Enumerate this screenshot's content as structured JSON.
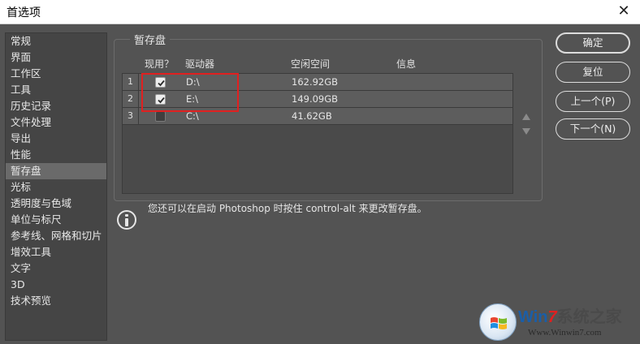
{
  "window": {
    "title": "首选项",
    "close_glyph": "✕"
  },
  "sidebar": {
    "items": [
      {
        "label": "常规"
      },
      {
        "label": "界面"
      },
      {
        "label": "工作区"
      },
      {
        "label": "工具"
      },
      {
        "label": "历史记录"
      },
      {
        "label": "文件处理"
      },
      {
        "label": "导出"
      },
      {
        "label": "性能"
      },
      {
        "label": "暂存盘",
        "active": true
      },
      {
        "label": "光标"
      },
      {
        "label": "透明度与色域"
      },
      {
        "label": "单位与标尺"
      },
      {
        "label": "参考线、网格和切片"
      },
      {
        "label": "增效工具"
      },
      {
        "label": "文字"
      },
      {
        "label": "3D"
      },
      {
        "label": "技术预览"
      }
    ]
  },
  "scratch": {
    "group_title": "暂存盘",
    "columns": {
      "active": "现用？",
      "drive": "驱动器",
      "free_space": "空闲空间",
      "info": "信息"
    },
    "rows": [
      {
        "num": "1",
        "checked": true,
        "drive": "D:\\",
        "free": "162.92GB",
        "info": ""
      },
      {
        "num": "2",
        "checked": true,
        "drive": "E:\\",
        "free": "149.09GB",
        "info": ""
      },
      {
        "num": "3",
        "checked": false,
        "drive": "C:\\",
        "free": "41.62GB",
        "info": ""
      }
    ],
    "info_note": "您还可以在启动 Photoshop 时按住 control-alt 来更改暂存盘。"
  },
  "buttons": {
    "ok": "确定",
    "reset": "复位",
    "prev": "上一个(P)",
    "next": "下一个(N)"
  },
  "watermark": {
    "brand_win": "Win",
    "brand_seven": "7",
    "brand_rest": "系统之家",
    "url": "Www.Winwin7.com"
  },
  "colors": {
    "dialog_bg": "#535353",
    "highlight": "#e02020",
    "brand_blue": "#1a5ea8"
  }
}
